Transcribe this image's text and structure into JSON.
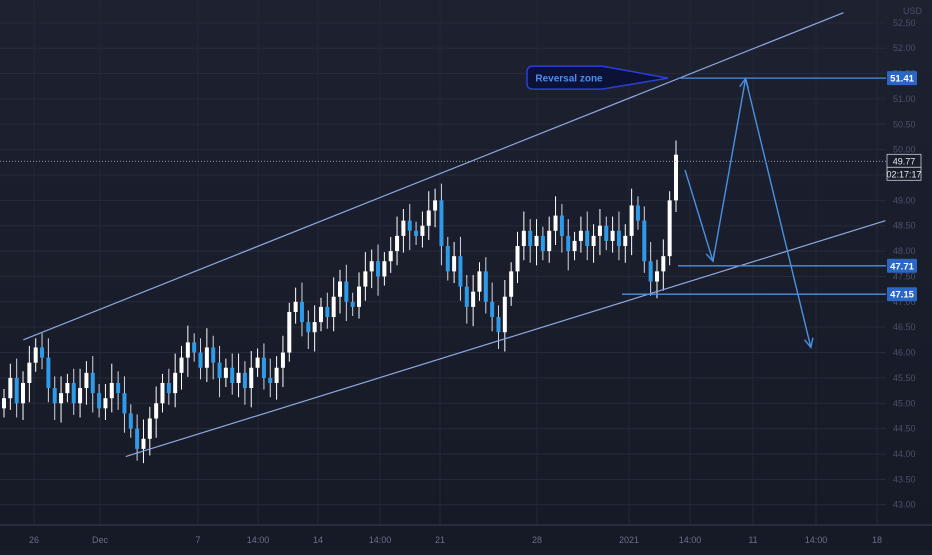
{
  "chart_data": {
    "type": "candlestick",
    "currency": "USD",
    "y_ticks": [
      43.0,
      43.5,
      44.0,
      44.5,
      45.0,
      45.5,
      46.0,
      46.5,
      47.0,
      47.5,
      48.0,
      48.5,
      49.0,
      49.5,
      50.0,
      50.5,
      51.0,
      51.5,
      52.0,
      52.5
    ],
    "ylim": [
      42.6,
      52.95
    ],
    "x_ticks": [
      "26",
      "Dec",
      "7",
      "14:00",
      "14",
      "14:00",
      "21",
      "28",
      "2021",
      "14:00",
      "11",
      "14:00",
      "18"
    ],
    "price_levels": [
      {
        "label": "51.41",
        "value": 51.41
      },
      {
        "label": "47.71",
        "value": 47.71
      },
      {
        "label": "47.15",
        "value": 47.15
      }
    ],
    "last_price": {
      "label": "49.77",
      "value": 49.77,
      "timer": "02:17:17"
    },
    "annotation": "Reversal zone",
    "channel": {
      "upper": {
        "from": [
          0.025,
          46.25
        ],
        "to": [
          0.905,
          52.7
        ]
      },
      "lower": {
        "from": [
          0.135,
          43.95
        ],
        "to": [
          0.95,
          48.6
        ]
      }
    },
    "forecast_path": [
      [
        0.735,
        49.6
      ],
      [
        0.765,
        47.8
      ],
      [
        0.8,
        51.4
      ],
      [
        0.87,
        46.1
      ]
    ],
    "closes": [
      45.1,
      45.5,
      45.0,
      45.4,
      45.8,
      46.1,
      45.9,
      45.3,
      45.0,
      45.2,
      45.4,
      45.0,
      45.3,
      45.6,
      45.2,
      44.9,
      45.1,
      45.4,
      45.2,
      44.8,
      44.5,
      44.1,
      44.3,
      44.7,
      45.0,
      45.4,
      45.2,
      45.6,
      45.9,
      46.2,
      46.0,
      45.7,
      46.1,
      45.8,
      45.5,
      45.7,
      45.4,
      45.6,
      45.3,
      45.7,
      45.9,
      45.5,
      45.4,
      45.7,
      46.0,
      46.8,
      47.0,
      46.6,
      46.4,
      46.6,
      46.9,
      46.7,
      47.1,
      47.4,
      47.0,
      46.9,
      47.3,
      47.6,
      47.8,
      47.5,
      47.8,
      48.0,
      48.3,
      48.6,
      48.4,
      48.3,
      48.5,
      48.8,
      49.0,
      48.1,
      47.6,
      47.9,
      47.3,
      46.9,
      47.2,
      47.6,
      47.0,
      46.7,
      46.4,
      47.1,
      47.6,
      48.1,
      48.4,
      48.1,
      48.3,
      48.0,
      48.4,
      48.7,
      48.3,
      48.0,
      48.2,
      48.4,
      48.1,
      48.3,
      48.5,
      48.2,
      48.4,
      48.1,
      48.3,
      48.9,
      48.6,
      47.8,
      47.4,
      47.6,
      47.9,
      49.0,
      49.9
    ]
  }
}
